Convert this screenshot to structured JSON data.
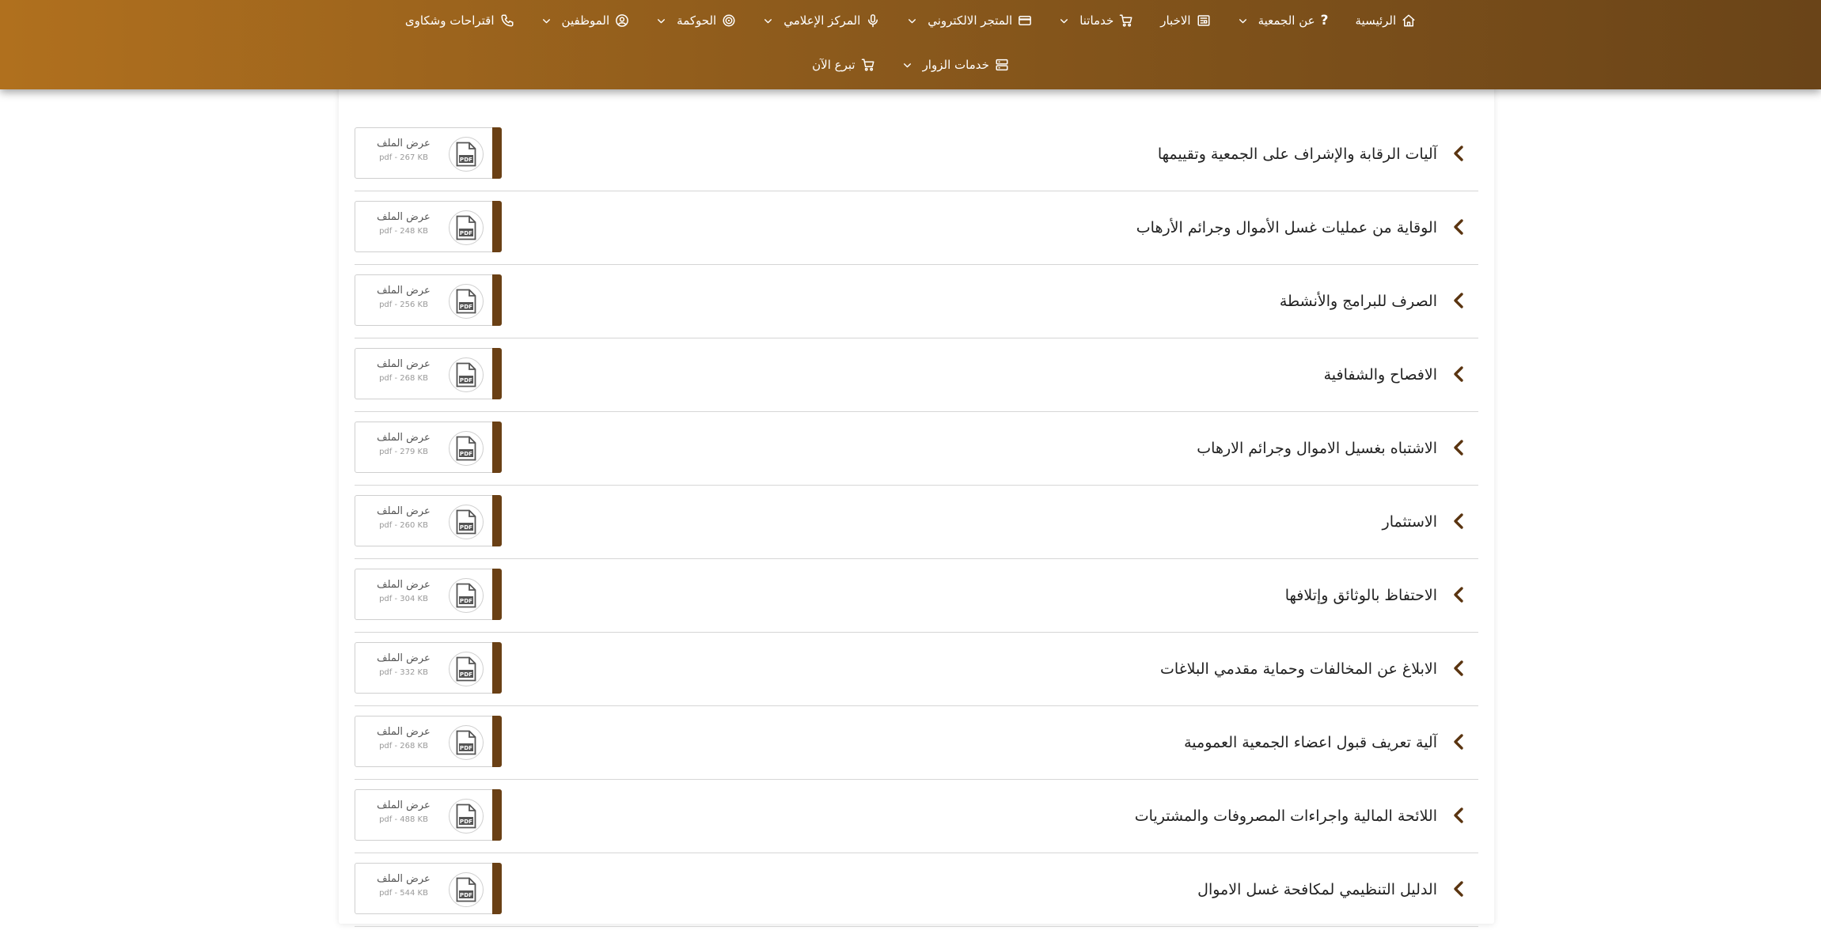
{
  "nav": {
    "row1": [
      {
        "key": "home",
        "label": "الرئيسية",
        "icon": "home-icon",
        "dropdown": false
      },
      {
        "key": "about",
        "label": "عن الجمعية",
        "icon": "question-icon",
        "dropdown": true
      },
      {
        "key": "news",
        "label": "الاخبار",
        "icon": "newspaper-icon",
        "dropdown": false
      },
      {
        "key": "services",
        "label": "خدماتنا",
        "icon": "cart-icon",
        "dropdown": true
      },
      {
        "key": "estore",
        "label": "المتجر الالكتروني",
        "icon": "credit-card-icon",
        "dropdown": true
      },
      {
        "key": "media",
        "label": "المركز الإعلامي",
        "icon": "microphone-icon",
        "dropdown": true
      },
      {
        "key": "governance",
        "label": "الحوكمة",
        "icon": "target-icon",
        "dropdown": true
      },
      {
        "key": "employees",
        "label": "الموظفين",
        "icon": "user-circle-icon",
        "dropdown": true
      },
      {
        "key": "suggestions",
        "label": "اقتراحات وشكاوى",
        "icon": "phone-icon",
        "dropdown": false
      }
    ],
    "row2": [
      {
        "key": "visitors",
        "label": "خدمات الزوار",
        "icon": "server-icon",
        "dropdown": true
      },
      {
        "key": "donate",
        "label": "تبرع الآن",
        "icon": "cart-icon",
        "dropdown": false
      }
    ]
  },
  "documents": [
    {
      "title": "آليات الرقابة والإشراف على الجمعية وتقييمها",
      "action": "عرض الملف",
      "meta": "pdf - 267 KB"
    },
    {
      "title": "الوقاية من عمليات غسل الأموال وجرائم الأرهاب",
      "action": "عرض الملف",
      "meta": "pdf - 248 KB"
    },
    {
      "title": "الصرف للبرامج والأنشطة",
      "action": "عرض الملف",
      "meta": "pdf - 256 KB"
    },
    {
      "title": "الافصاح والشفافية",
      "action": "عرض الملف",
      "meta": "pdf - 268 KB"
    },
    {
      "title": "الاشتباه بغسيل الاموال وجرائم الارهاب",
      "action": "عرض الملف",
      "meta": "pdf - 279 KB"
    },
    {
      "title": "الاستثمار",
      "action": "عرض الملف",
      "meta": "pdf - 260 KB"
    },
    {
      "title": "الاحتفاظ بالوثائق وإتلافها",
      "action": "عرض الملف",
      "meta": "pdf - 304 KB"
    },
    {
      "title": "الابلاغ عن المخالفات وحماية مقدمي البلاغات",
      "action": "عرض الملف",
      "meta": "pdf - 332 KB"
    },
    {
      "title": "آلية تعريف قبول اعضاء الجمعية العمومية",
      "action": "عرض الملف",
      "meta": "pdf - 268 KB"
    },
    {
      "title": "اللائحة المالية واجراءات المصروفات والمشتريات",
      "action": "عرض الملف",
      "meta": "pdf - 488 KB"
    },
    {
      "title": "الدليل التنظيمي لمكافحة غسل الاموال",
      "action": "عرض الملف",
      "meta": "pdf - 544 KB"
    }
  ],
  "colors": {
    "header_start": "#b0701e",
    "header_end": "#6a4418",
    "accent_bar": "#6a4015",
    "row_arrow": "#5a3410"
  }
}
